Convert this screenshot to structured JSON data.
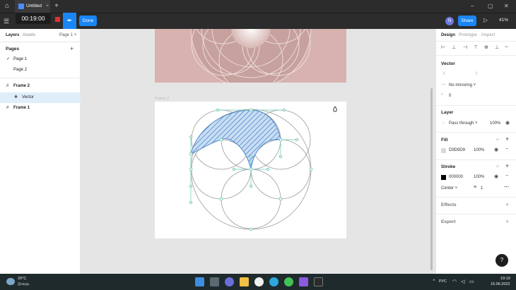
{
  "titlebar": {
    "tab_title": "Untitled",
    "close": "×",
    "new_tab": "+",
    "minimize": "–",
    "maximize": "▢",
    "close_window": "✕"
  },
  "toolbar": {
    "timer": "00:19:00",
    "done_label": "Done",
    "avatar_letter": "N",
    "share_label": "Share",
    "zoom": "41%"
  },
  "left_panel": {
    "tabs": [
      "Layers",
      "Assets"
    ],
    "page_selector": "Page 1",
    "pages_title": "Pages",
    "pages": [
      "Page 1",
      "Page 2"
    ],
    "layers": [
      {
        "name": "Frame 2",
        "type": "frame"
      },
      {
        "name": "Vector",
        "type": "vector",
        "selected": true
      },
      {
        "name": "Frame 1",
        "type": "frame"
      }
    ]
  },
  "canvas": {
    "frame_label": "Frame 2"
  },
  "right_panel": {
    "tabs": [
      "Design",
      "Prototype",
      "Inspect"
    ],
    "vector": {
      "title": "Vector",
      "x_label": "X",
      "y_label": "Y",
      "mirroring": "No mirroring",
      "radius": "0"
    },
    "layer": {
      "title": "Layer",
      "blend": "Pass through",
      "opacity": "100%"
    },
    "fill": {
      "title": "Fill",
      "hex": "D9D9D9",
      "opacity": "100%",
      "color": "#D9D9D9"
    },
    "stroke": {
      "title": "Stroke",
      "hex": "000000",
      "opacity": "100%",
      "position": "Center",
      "weight": "1",
      "color": "#000000"
    },
    "effects_title": "Effects",
    "export_title": "Export",
    "help": "?"
  },
  "taskbar": {
    "weather_temp": "20°C",
    "weather_desc": "Дождь",
    "lang": "РУС",
    "time": "19:19",
    "date": "16.06.2022"
  }
}
